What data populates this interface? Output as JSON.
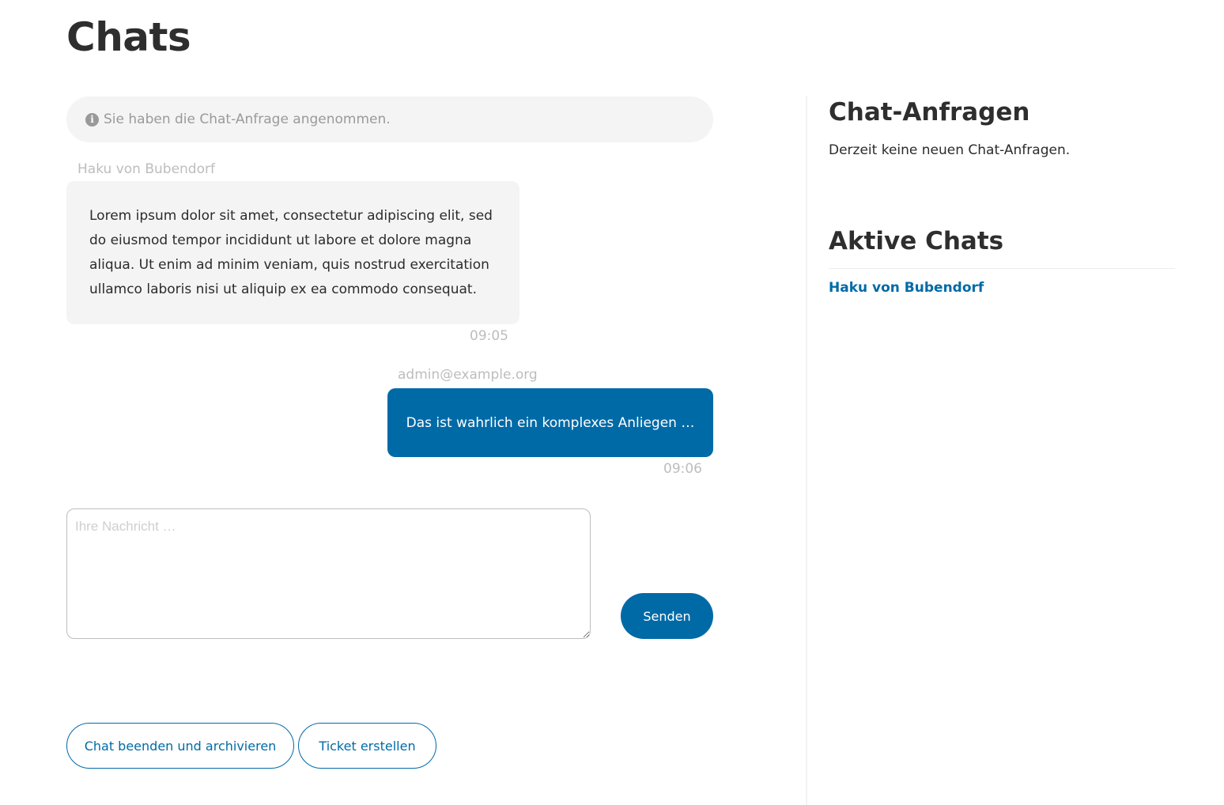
{
  "page": {
    "title": "Chats"
  },
  "chat": {
    "notice": "Sie haben die Chat-Anfrage angenommen.",
    "messages": [
      {
        "sender": "Haku von Bubendorf",
        "text": "Lorem ipsum dolor sit amet, consectetur adipiscing elit, sed do eiusmod tempor incididunt ut labore et dolore magna aliqua. Ut enim ad minim veniam, quis nostrud exercitation ullamco laboris nisi ut aliquip ex ea commodo consequat.",
        "time": "09:05",
        "direction": "incoming"
      },
      {
        "sender": "admin@example.org",
        "text": "Das ist wahrlich ein komplexes Anliegen …",
        "time": "09:06",
        "direction": "outgoing"
      }
    ],
    "input": {
      "placeholder": "Ihre Nachricht …",
      "value": ""
    },
    "send_label": "Senden",
    "actions": {
      "archive_label": "Chat beenden und archivieren",
      "ticket_label": "Ticket erstellen"
    }
  },
  "sidebar": {
    "requests": {
      "heading": "Chat-Anfragen",
      "empty_text": "Derzeit keine neuen Chat-Anfragen."
    },
    "active": {
      "heading": "Aktive Chats",
      "items": [
        {
          "label": "Haku von Bubendorf"
        }
      ]
    }
  },
  "colors": {
    "accent": "#006aa7",
    "bubble_incoming": "#f4f4f4",
    "muted_text": "#bdbdbd"
  }
}
